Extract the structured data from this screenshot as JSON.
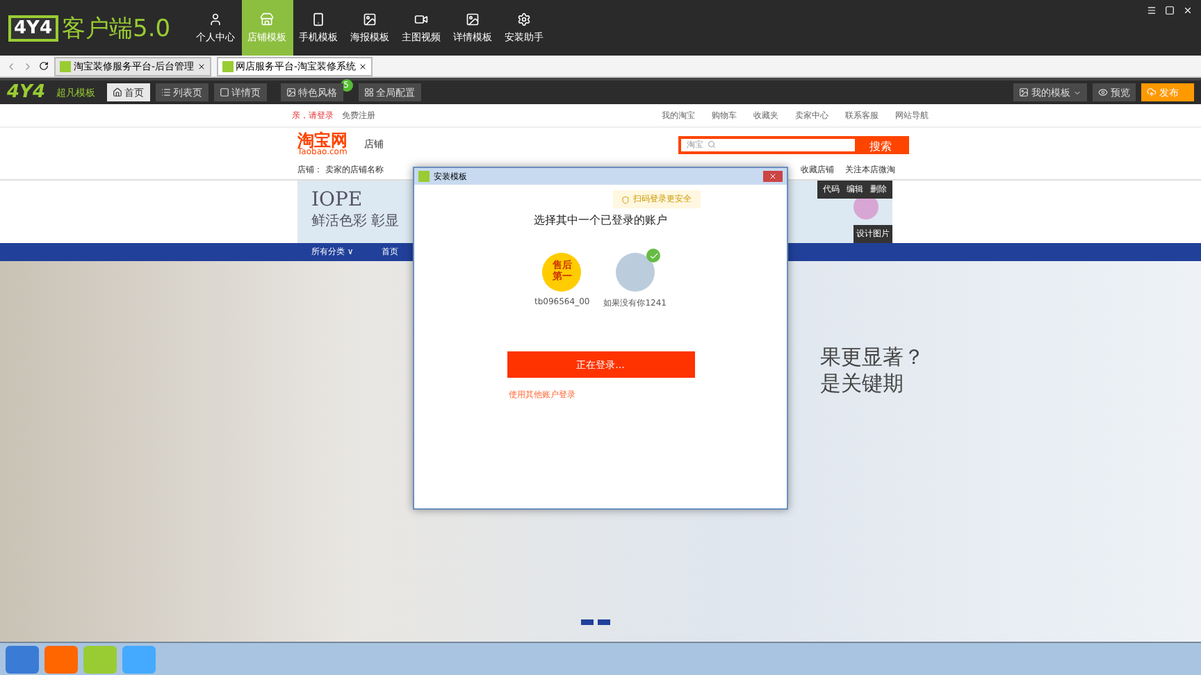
{
  "app": {
    "logo": "4Y4",
    "title": "客户端5.0"
  },
  "nav": [
    {
      "label": "个人中心",
      "selected": false
    },
    {
      "label": "店铺模板",
      "selected": true
    },
    {
      "label": "手机模板",
      "selected": false
    },
    {
      "label": "海报模板",
      "selected": false
    },
    {
      "label": "主图视频",
      "selected": false
    },
    {
      "label": "详情模板",
      "selected": false
    },
    {
      "label": "安装助手",
      "selected": false
    }
  ],
  "browser_tabs": [
    {
      "title": "淘宝装修服务平台-后台管理",
      "selected": false
    },
    {
      "title": "网店服务平台-淘宝装修系统",
      "selected": true
    }
  ],
  "toolbar": {
    "logo": "4Y4",
    "subtitle": "超凡模板",
    "pages": [
      {
        "label": "首页",
        "selected": true
      },
      {
        "label": "列表页",
        "selected": false
      },
      {
        "label": "详情页",
        "selected": false
      }
    ],
    "style_button": {
      "label": "特色风格",
      "badge": "5"
    },
    "config_button": "全局配置",
    "my_templates": "我的模板",
    "preview": "预览",
    "publish": "发布"
  },
  "store": {
    "login": "亲，请登录",
    "register": "免费注册",
    "top_links": [
      "我的淘宝",
      "购物车",
      "收藏夹",
      "卖家中心",
      "联系客服",
      "网站导航"
    ],
    "logo": "淘宝网",
    "logo_sub": "Taobao.com",
    "shop_label": "店铺",
    "search_scope": "淘宝",
    "search_button": "搜索",
    "shop_name": "店铺：  卖家的店铺名称",
    "favorite_shop": "收藏店铺",
    "follow": "关注本店微淘",
    "edit_tools": [
      "代码",
      "编辑",
      "删除"
    ],
    "design_label": "设计图片",
    "banner": {
      "title": "IOPE",
      "subtitle": "鲜活色彩 彰显"
    },
    "menu": [
      "所有分类 ∨",
      "首页"
    ],
    "hero": [
      "果更显著？",
      "是关键期"
    ]
  },
  "dialog": {
    "title": "安装模板",
    "badge": "扫码登录更安全",
    "heading": "选择其中一个已登录的账户",
    "accounts": [
      {
        "name": "tb096564_00",
        "avatar": "售后第一",
        "selected": false
      },
      {
        "name": "如果没有你1241",
        "selected": true
      }
    ],
    "button": "正在登录...",
    "link": "使用其他账户登录"
  }
}
